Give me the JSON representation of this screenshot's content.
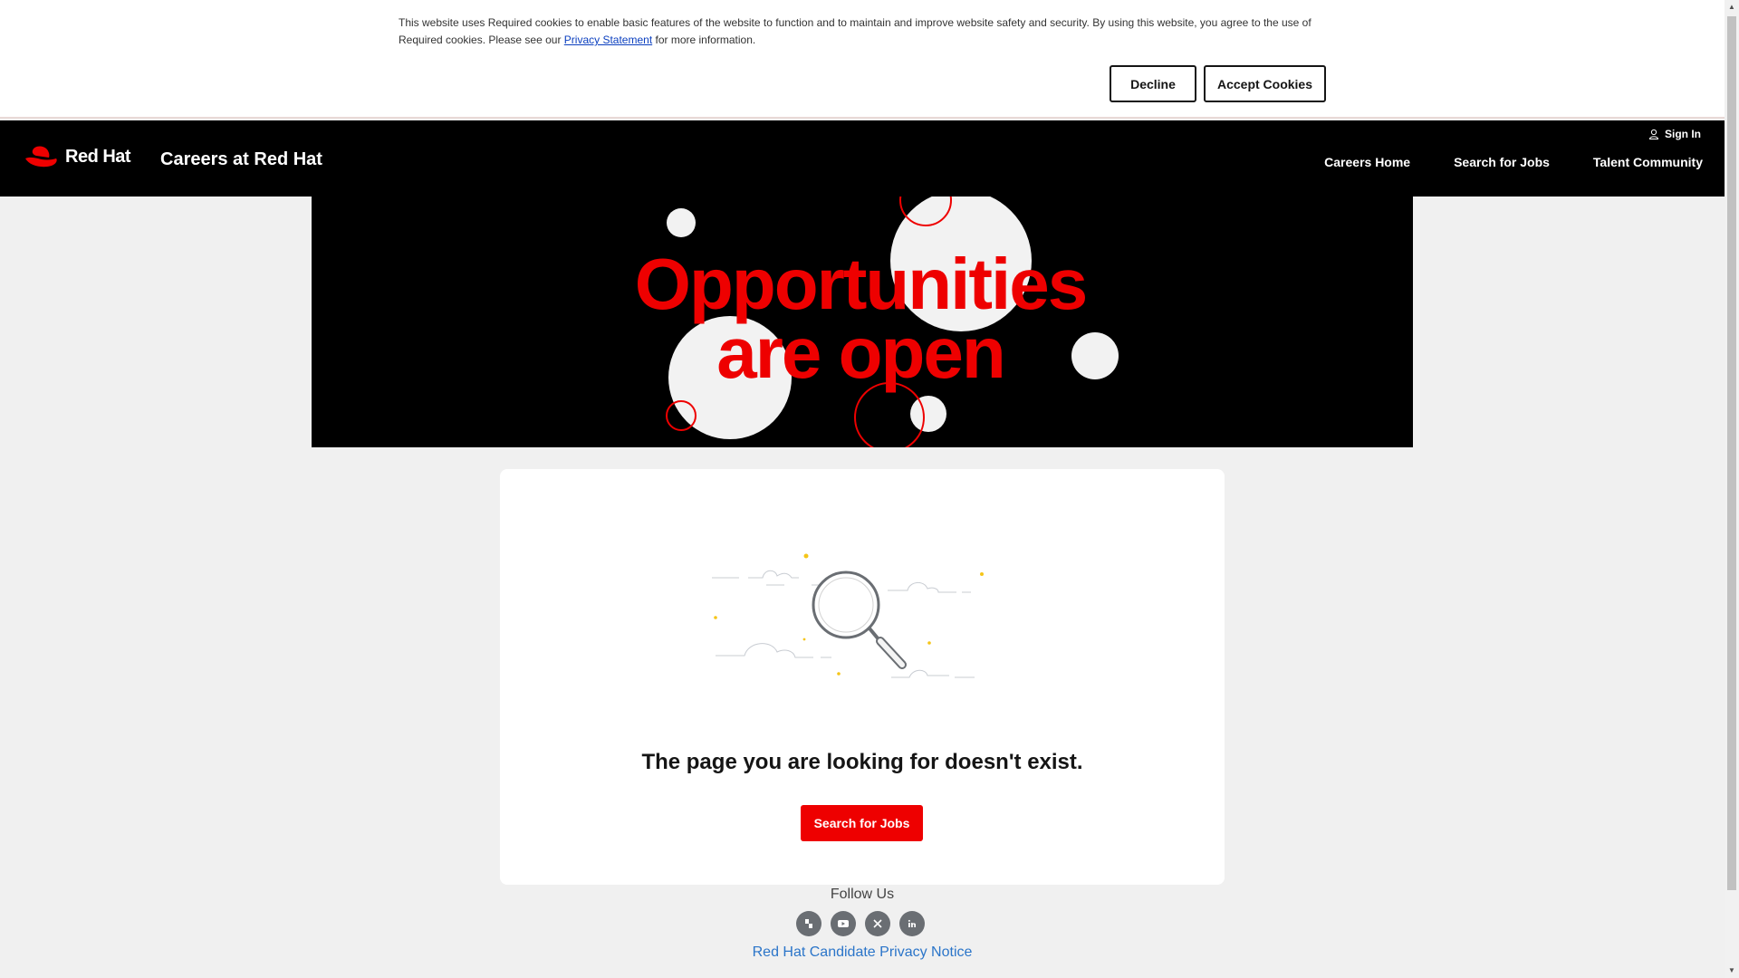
{
  "cookie_banner": {
    "text_before": "This website uses Required cookies to enable basic features of the website to function and to maintain and improve website safety and security. By using this website, you agree to the use of Required cookies. Please see our ",
    "link": "Privacy Statement",
    "text_after": " for more information.",
    "decline_label": "Decline",
    "accept_label": "Accept Cookies"
  },
  "header": {
    "logo_text": "Red Hat",
    "site_title": "Careers at Red Hat",
    "signin_label": "Sign In",
    "nav": [
      "Careers Home",
      "Search for Jobs",
      "Talent Community"
    ]
  },
  "hero": {
    "line1": "Opportunities",
    "line2": "are open",
    "text_color": "#ee0000"
  },
  "main": {
    "message": "The page you are looking for doesn't exist.",
    "button_label": "Search for Jobs"
  },
  "footer": {
    "follow_label": "Follow Us",
    "socials": [
      "glassdoor-icon",
      "youtube-icon",
      "x-icon",
      "linkedin-icon"
    ],
    "privacy_link": "Red Hat Candidate Privacy Notice"
  },
  "colors": {
    "brand_red": "#ee0000",
    "header_bg": "#000000",
    "page_bg": "#f0f0f0",
    "link_blue": "#2b75c9"
  }
}
